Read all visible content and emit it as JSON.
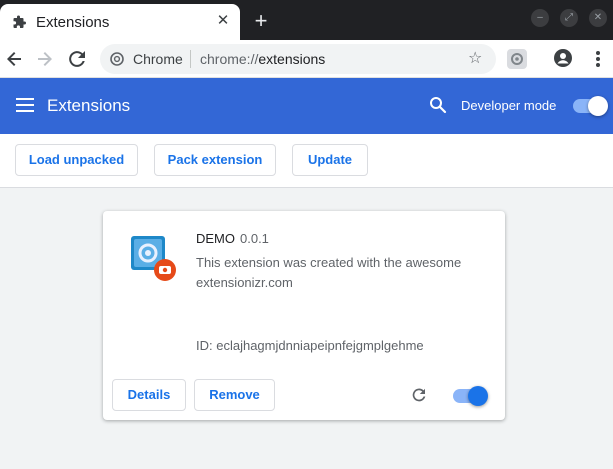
{
  "browser": {
    "tab_title": "Extensions",
    "new_tab_symbol": "+",
    "tab_close_symbol": "✕",
    "window_minimize": "–",
    "window_restore": "⤢",
    "window_close": "✕",
    "omnibox_site": "Chrome",
    "omnibox_scheme": "chrome://",
    "omnibox_path": "extensions",
    "bookmark_star": "☆"
  },
  "header": {
    "title": "Extensions",
    "developer_mode_label": "Developer mode",
    "developer_mode_on": true
  },
  "dev_toolbar": {
    "load_unpacked": "Load unpacked",
    "pack_extension": "Pack extension",
    "update": "Update"
  },
  "extension": {
    "name": "DEMO",
    "version": "0.0.1",
    "description": "This extension was created with the awesome extensionizr.com",
    "id": "ID: eclajhagmjdnniapeipnfejgmplgehme",
    "details_label": "Details",
    "remove_label": "Remove",
    "enabled": true
  },
  "colors": {
    "header_blue": "#3367d6",
    "accent": "#1a73e8",
    "titlebar": "#202124"
  }
}
